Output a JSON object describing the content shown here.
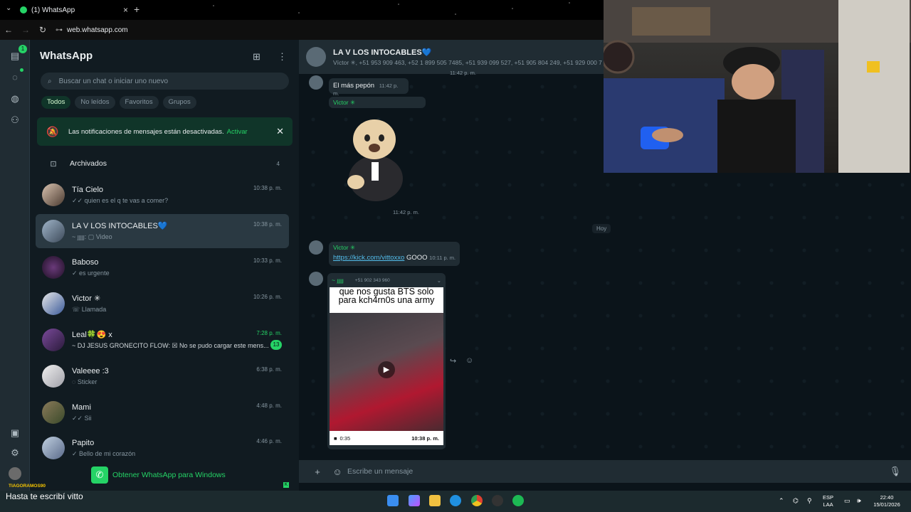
{
  "browser": {
    "tab_title": "(1) WhatsApp",
    "url": "web.whatsapp.com"
  },
  "rail": {
    "notification_count": "1"
  },
  "app": {
    "title": "WhatsApp",
    "search_placeholder": "Buscar un chat o iniciar uno nuevo",
    "filters": [
      "Todos",
      "No leídos",
      "Favoritos",
      "Grupos"
    ],
    "notice_text": "Las notificaciones de mensajes están desactivadas.",
    "notice_action": "Activar",
    "archived_label": "Archivados",
    "archived_count": "4",
    "get_app": "Obtener WhatsApp para Windows"
  },
  "chats": [
    {
      "name": "Tía Cielo",
      "preview": "✓✓ quien es el q te vas a comer?",
      "time": "10:38 p. m."
    },
    {
      "name": "LA V LOS INTOCABLES💙",
      "preview": "~ ȷȷȷȷȷ: ▢ Video",
      "time": "10:38 p. m."
    },
    {
      "name": "Baboso",
      "preview": "✓ es urgente",
      "time": "10:33 p. m."
    },
    {
      "name": "Victor ✳",
      "preview": "☏ Llamada",
      "time": "10:26 p. m."
    },
    {
      "name": "Leal🍀😍 x",
      "preview": "~ DJ JESUS GRONECITO FLOW: ☒ No se pudo cargar este mens...",
      "time": "7:28 p. m.",
      "unread": "13"
    },
    {
      "name": "Valeeee :3",
      "preview": "◌ Sticker",
      "time": "6:38 p. m."
    },
    {
      "name": "Mami",
      "preview": "✓✓ Sii",
      "time": "4:48 p. m."
    },
    {
      "name": "Papito",
      "preview": "✓ Bello de mi corazón",
      "time": "4:46 p. m."
    }
  ],
  "conversation": {
    "title": "LA V LOS INTOCABLES💙",
    "members": "Víctor ✳, +51 953 909 463, +52 1 899 505 7485, +51 939 099 527, +51 905 804 249, +51 929 000 7",
    "messages": {
      "top_time": "11:42 p. m.",
      "m1_text": "El más pepón",
      "m1_time": "11:42 p. m.",
      "m2_sender": "Victor ✳",
      "m2_time": "11:42 p. m.",
      "day": "Hoy",
      "m3_sender": "Victor ✳",
      "m3_link": "https://kick.com/vittoxxo",
      "m3_text": "GOOO",
      "m3_time": "10:11 p. m.",
      "m4_sender": "~ ȷȷȷȷȷ",
      "m4_phone": "+51 902 343 960",
      "m4_caption": "que nos gusta BTS solo para kch4rn0s una army",
      "m4_duration": "0:35",
      "m4_time": "10:38 p. m."
    },
    "composer_placeholder": "Escribe un mensaje"
  },
  "overlay": {
    "streamer": "TIAGORAMOS90",
    "subtitle": "Hasta te escribí vitto"
  },
  "tray": {
    "lang1": "ESP",
    "lang2": "LAA",
    "time": "22:40",
    "date": "15/01/2026"
  }
}
